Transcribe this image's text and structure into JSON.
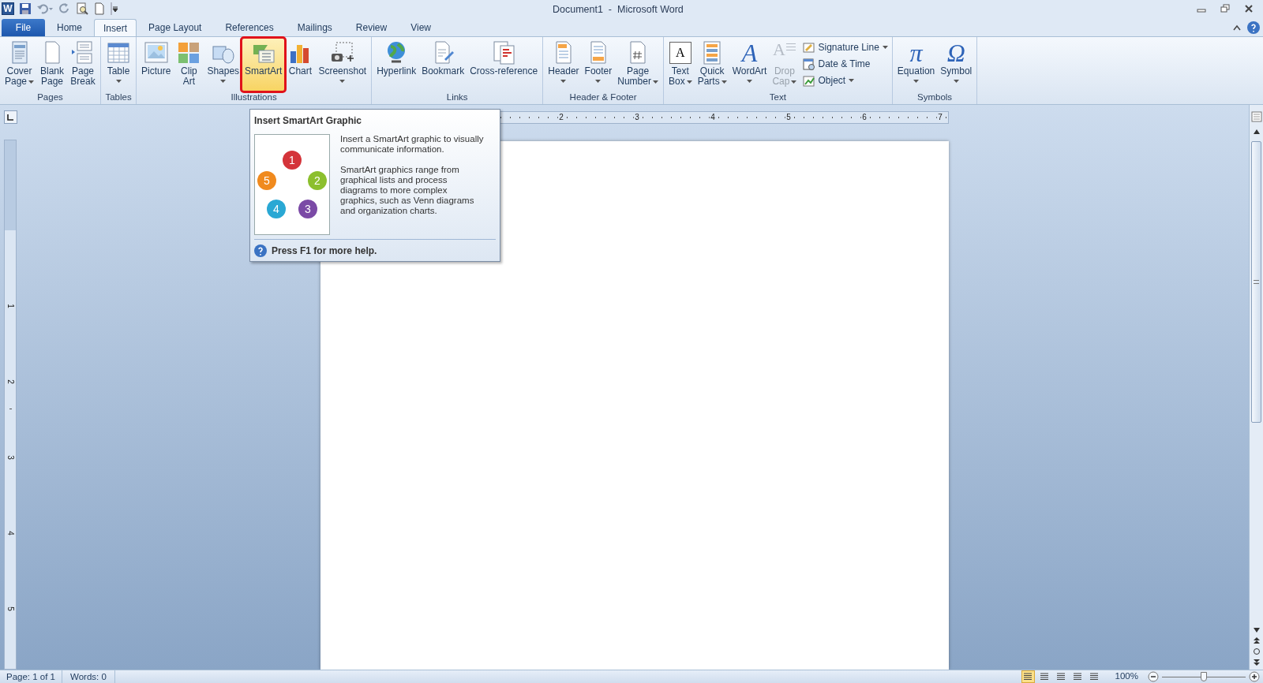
{
  "window": {
    "app_letter": "W",
    "title": "Document1  -  Microsoft Word"
  },
  "tabs": [
    {
      "label": "File",
      "kind": "file",
      "selected": false
    },
    {
      "label": "Home",
      "kind": "tab",
      "selected": false
    },
    {
      "label": "Insert",
      "kind": "tab",
      "selected": true
    },
    {
      "label": "Page Layout",
      "kind": "tab",
      "selected": false
    },
    {
      "label": "References",
      "kind": "tab",
      "selected": false
    },
    {
      "label": "Mailings",
      "kind": "tab",
      "selected": false
    },
    {
      "label": "Review",
      "kind": "tab",
      "selected": false
    },
    {
      "label": "View",
      "kind": "tab",
      "selected": false
    }
  ],
  "ribbon_groups": [
    {
      "label": "Pages",
      "buttons": [
        {
          "label": [
            "Cover",
            "Page"
          ],
          "menu": true,
          "selected": false,
          "disabled": false
        },
        {
          "label": [
            "Blank",
            "Page"
          ],
          "menu": false,
          "selected": false,
          "disabled": false
        },
        {
          "label": [
            "Page",
            "Break"
          ],
          "menu": false,
          "selected": false,
          "disabled": false
        }
      ]
    },
    {
      "label": "Tables",
      "buttons": [
        {
          "label": [
            "Table"
          ],
          "menu": true,
          "selected": false,
          "disabled": false
        }
      ]
    },
    {
      "label": "Illustrations",
      "buttons": [
        {
          "label": [
            "Picture"
          ],
          "menu": false,
          "selected": false,
          "disabled": false
        },
        {
          "label": [
            "Clip",
            "Art"
          ],
          "menu": false,
          "selected": false,
          "disabled": false
        },
        {
          "label": [
            "Shapes"
          ],
          "menu": true,
          "selected": false,
          "disabled": false
        },
        {
          "label": [
            "SmartArt"
          ],
          "menu": false,
          "selected": true,
          "disabled": false
        },
        {
          "label": [
            "Chart"
          ],
          "menu": false,
          "selected": false,
          "disabled": false
        },
        {
          "label": [
            "Screenshot"
          ],
          "menu": true,
          "selected": false,
          "disabled": false
        }
      ]
    },
    {
      "label": "Links",
      "buttons": [
        {
          "label": [
            "Hyperlink"
          ],
          "menu": false,
          "selected": false,
          "disabled": false
        },
        {
          "label": [
            "Bookmark"
          ],
          "menu": false,
          "selected": false,
          "disabled": false
        },
        {
          "label": [
            "Cross-reference"
          ],
          "menu": false,
          "selected": false,
          "disabled": false
        }
      ]
    },
    {
      "label": "Header & Footer",
      "buttons": [
        {
          "label": [
            "Header"
          ],
          "menu": true,
          "selected": false,
          "disabled": false
        },
        {
          "label": [
            "Footer"
          ],
          "menu": true,
          "selected": false,
          "disabled": false
        },
        {
          "label": [
            "Page",
            "Number"
          ],
          "menu": true,
          "selected": false,
          "disabled": false
        }
      ]
    },
    {
      "label": "Text",
      "buttons": [
        {
          "label": [
            "Text",
            "Box"
          ],
          "menu": true,
          "selected": false,
          "disabled": false,
          "glyph": "A"
        },
        {
          "label": [
            "Quick",
            "Parts"
          ],
          "menu": true,
          "selected": false,
          "disabled": false
        },
        {
          "label": [
            "WordArt"
          ],
          "menu": true,
          "selected": false,
          "disabled": false,
          "glyph": "A"
        },
        {
          "label": [
            "Drop",
            "Cap"
          ],
          "menu": true,
          "selected": false,
          "disabled": true,
          "glyph": "A"
        }
      ],
      "small_buttons": [
        {
          "label": "Signature Line",
          "menu": true
        },
        {
          "label": "Date & Time",
          "menu": false
        },
        {
          "label": "Object",
          "menu": true
        }
      ]
    },
    {
      "label": "Symbols",
      "buttons": [
        {
          "label": [
            "Equation"
          ],
          "menu": true,
          "selected": false,
          "disabled": false,
          "glyph": "π"
        },
        {
          "label": [
            "Symbol"
          ],
          "menu": true,
          "selected": false,
          "disabled": false,
          "glyph": "Ω"
        }
      ]
    }
  ],
  "tooltip": {
    "title": "Insert SmartArt Graphic",
    "graphic_numbers": [
      "1",
      "2",
      "3",
      "4",
      "5"
    ],
    "paragraphs": [
      "Insert a SmartArt graphic to visually communicate information.",
      "SmartArt graphics range from graphical lists and process diagrams to more complex graphics, such as Venn diagrams and organization charts."
    ],
    "help": "Press F1 for more help."
  },
  "horizontal_ruler": [
    "2",
    "3",
    "4",
    "5",
    "6",
    "7"
  ],
  "vertical_ruler": [
    "1",
    "2",
    "3",
    "4",
    "5"
  ],
  "status_bar": {
    "page": "Page: 1 of 1",
    "words": "Words: 0",
    "views": [
      {
        "selected": true
      },
      {
        "selected": false
      },
      {
        "selected": false
      },
      {
        "selected": false
      },
      {
        "selected": false
      }
    ],
    "zoom": {
      "reading": "100%",
      "level": 0.5
    }
  }
}
